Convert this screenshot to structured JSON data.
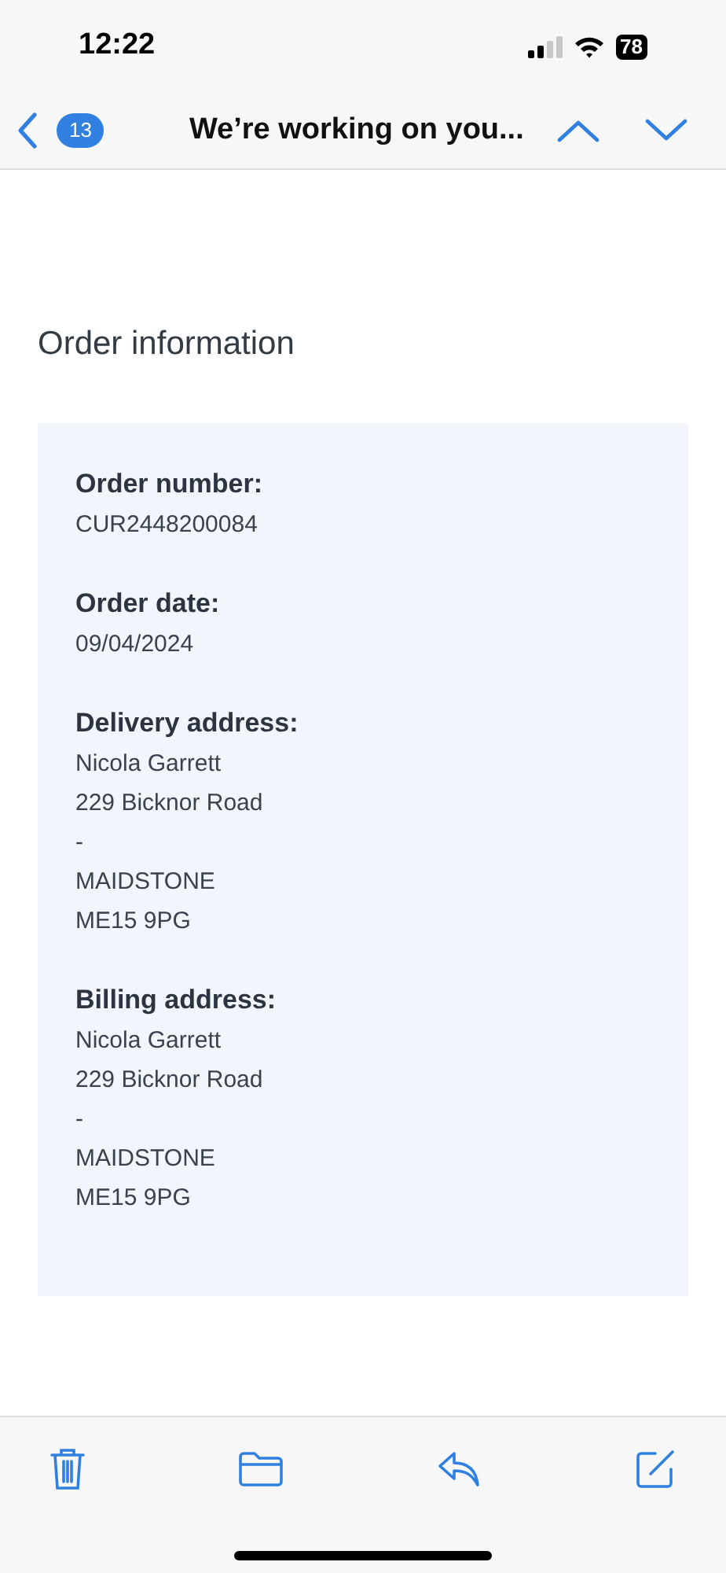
{
  "status_bar": {
    "time": "12:22",
    "battery": "78"
  },
  "nav": {
    "unread_count": "13",
    "title": "We’re working on you..."
  },
  "heading": "Order information",
  "sections": [
    {
      "label": "Order number:",
      "lines": [
        "CUR2448200084"
      ]
    },
    {
      "label": "Order date:",
      "lines": [
        "09/04/2024"
      ]
    },
    {
      "label": "Delivery address:",
      "lines": [
        "Nicola Garrett",
        "229 Bicknor Road",
        "-",
        "MAIDSTONE",
        "ME15 9PG"
      ]
    },
    {
      "label": "Billing address:",
      "lines": [
        "Nicola Garrett",
        "229 Bicknor Road",
        "-",
        "MAIDSTONE",
        "ME15 9PG"
      ]
    }
  ]
}
